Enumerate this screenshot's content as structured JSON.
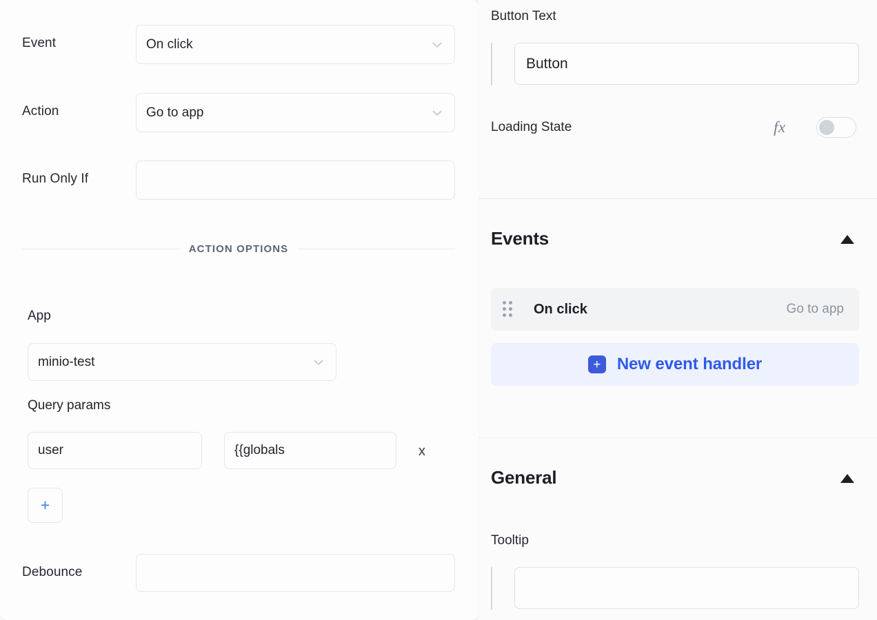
{
  "left_panel": {
    "event": {
      "label": "Event",
      "value": "On click"
    },
    "action": {
      "label": "Action",
      "value": "Go to app"
    },
    "run_only_if": {
      "label": "Run Only If",
      "value": "",
      "placeholder": ""
    },
    "action_options_divider": "ACTION OPTIONS",
    "app": {
      "label": "App",
      "value": "minio-test"
    },
    "query_params": {
      "label": "Query params",
      "rows": [
        {
          "key": "user",
          "value": "{{globals",
          "remove_label": "x"
        }
      ],
      "add_label": "+"
    },
    "debounce": {
      "label": "Debounce",
      "value": "",
      "placeholder": ""
    }
  },
  "right_panel": {
    "button_text": {
      "label": "Button Text",
      "value": "Button"
    },
    "loading_state": {
      "label": "Loading State",
      "fx_label": "fx",
      "enabled": false
    },
    "events": {
      "title": "Events",
      "collapse_icon": "caret-up",
      "handlers": [
        {
          "name": "On click",
          "action": "Go to app"
        }
      ],
      "new_handler_label": "New event handler",
      "new_handler_plus": "+"
    },
    "general": {
      "title": "General",
      "collapse_icon": "caret-up",
      "tooltip": {
        "label": "Tooltip",
        "value": "",
        "placeholder": ""
      }
    }
  },
  "colors": {
    "accent_blue": "#2f5bea",
    "badge_blue": "#3b5bdb",
    "new_event_bg": "#eef1fe",
    "event_row_bg": "#f2f3f5",
    "border": "#e3e6ea",
    "text": "#1f2328",
    "muted": "#8b949e"
  }
}
